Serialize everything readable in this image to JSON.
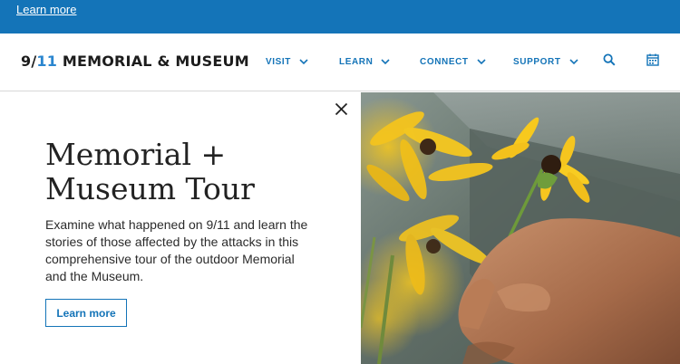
{
  "top_bar": {
    "link_label": "Learn more",
    "background": "#1474b8"
  },
  "nav": {
    "logo": {
      "number": "9",
      "slash": "/",
      "bars": "11",
      "name": "MEMORIAL & MUSEUM"
    },
    "items": [
      {
        "label": "VISIT",
        "icon": "chevron-down-icon"
      },
      {
        "label": "LEARN",
        "icon": "chevron-down-icon"
      },
      {
        "label": "CONNECT",
        "icon": "chevron-down-icon"
      },
      {
        "label": "SUPPORT",
        "icon": "chevron-down-icon"
      }
    ],
    "search_icon": "search-icon",
    "calendar_icon": "calendar-icon",
    "accent": "#1474b8"
  },
  "panel": {
    "title_line1": "Memorial +",
    "title_line2": "Museum Tour",
    "description": "Examine what happened on 9/11 and learn the stories of those affected by the attacks in this comprehensive tour of the outdoor Memorial and the Museum.",
    "cta_label": "Learn more",
    "close_icon": "close-icon"
  }
}
